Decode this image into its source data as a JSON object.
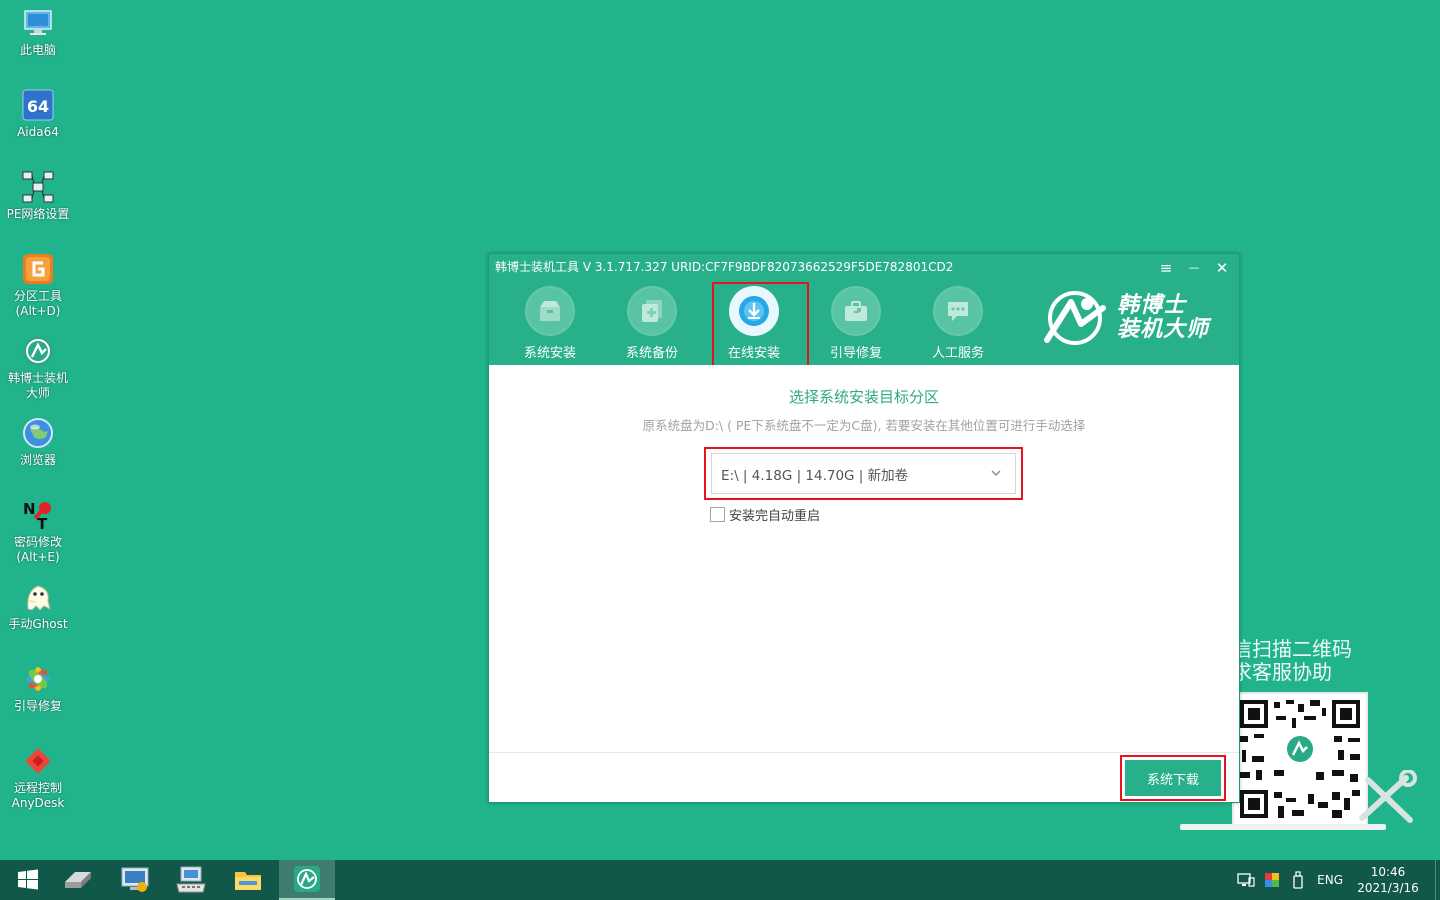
{
  "desktop": {
    "icons": [
      {
        "label": "此电脑",
        "icon": "this-pc-icon"
      },
      {
        "label": "Aida64",
        "icon": "aida64-icon"
      },
      {
        "label": "PE网络设置",
        "icon": "network-settings-icon"
      },
      {
        "label": "分区工具\n(Alt+D)",
        "icon": "partition-tool-icon"
      },
      {
        "label": "韩博士装机\n大师",
        "icon": "hanboshi-icon"
      },
      {
        "label": "浏览器",
        "icon": "browser-icon"
      },
      {
        "label": "密码修改\n(Alt+E)",
        "icon": "password-change-icon"
      },
      {
        "label": "手动Ghost",
        "icon": "ghost-icon"
      },
      {
        "label": "引导修复",
        "icon": "boot-repair-icon"
      },
      {
        "label": "远程控制\nAnyDesk",
        "icon": "anydesk-icon"
      }
    ],
    "qr": {
      "text": "信扫描二维码\n求客服协助"
    }
  },
  "window": {
    "title": "韩博士装机工具 V 3.1.717.327 URID:CF7F9BDF82073662529F5DE782801CD2",
    "controls": {
      "menu": "≡",
      "minimize": "—",
      "close": "✕"
    },
    "tabs": [
      {
        "label": "系统安装",
        "icon": "system-install-icon"
      },
      {
        "label": "系统备份",
        "icon": "system-backup-icon"
      },
      {
        "label": "在线安装",
        "icon": "online-install-icon",
        "active": true
      },
      {
        "label": "引导修复",
        "icon": "boot-repair-icon"
      },
      {
        "label": "人工服务",
        "icon": "chat-service-icon"
      }
    ],
    "brand": {
      "text": "韩博士\n装机大师"
    },
    "content": {
      "title": "选择系统安装目标分区",
      "subtitle": "原系统盘为D:\\ ( PE下系统盘不一定为C盘), 若要安装在其他位置可进行手动选择",
      "partition_selected": "E:\\ | 4.18G | 14.70G | 新加卷",
      "auto_reboot_label": "安装完自动重启",
      "auto_reboot_checked": false
    },
    "footer": {
      "download_button": "系统下载"
    }
  },
  "taskbar": {
    "items": [
      "start-icon",
      "drive-icon",
      "system-monitor-icon",
      "keyboard-computer-icon",
      "file-explorer-icon",
      "hanboshi-app-icon"
    ],
    "active_item": "hanboshi-app-icon",
    "language": "ENG",
    "time": "10:46",
    "date": "2021/3/16"
  },
  "colors": {
    "desktop_bg": "#21b48c",
    "accent": "#27b08a",
    "highlight_red": "#e3141e",
    "taskbar_bg": "#11584b"
  }
}
